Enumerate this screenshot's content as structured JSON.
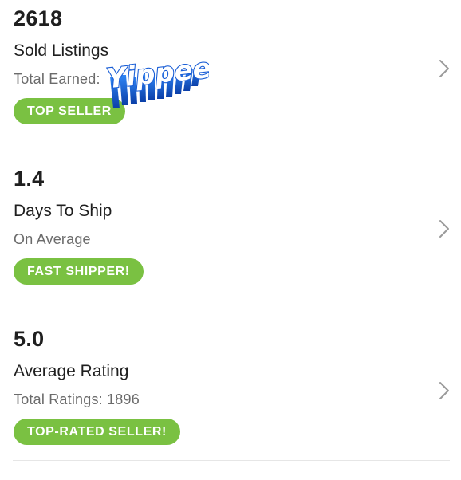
{
  "stats": [
    {
      "value": "2618",
      "label": "Sold Listings",
      "sub": "Total Earned:",
      "badge": "TOP SELLER"
    },
    {
      "value": "1.4",
      "label": "Days To Ship",
      "sub": "On Average",
      "badge": "FAST SHIPPER!"
    },
    {
      "value": "5.0",
      "label": "Average Rating",
      "sub": "Total Ratings: 1896",
      "badge": "TOP-RATED SELLER!"
    }
  ],
  "sticker": {
    "text": "Yippee!",
    "icon": "yippee-sticker-icon"
  },
  "colors": {
    "badge": "#7ac142",
    "primary_text": "#1f1f1f",
    "secondary_text": "#6b6b6b",
    "divider": "#e6e6e6",
    "sticker_blue": "#1f6fe0"
  }
}
